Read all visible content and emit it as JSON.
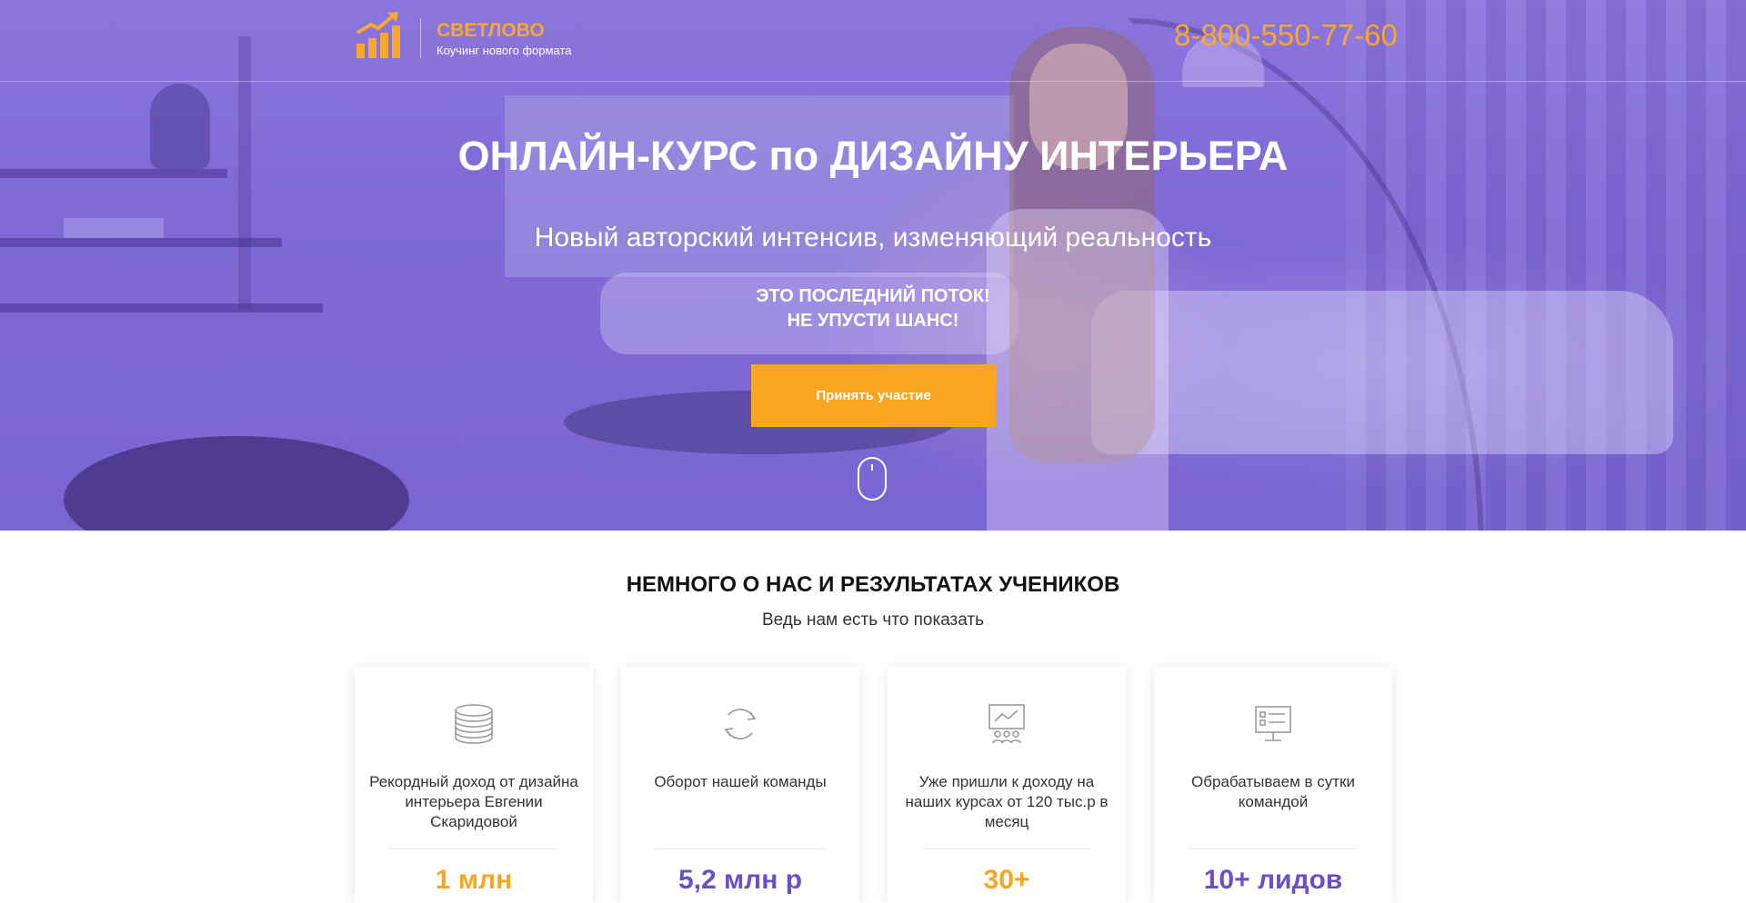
{
  "header": {
    "logo_title": "СВЕТЛОВО",
    "logo_subtitle": "Коучинг нового формата",
    "phone": "8-800-550-77-60"
  },
  "hero": {
    "title": "ОНЛАЙН-КУРС по ДИЗАЙНУ ИНТЕРЬЕРА",
    "subtitle": "Новый авторский интенсив, изменяющий реальность",
    "urgent_line1": "ЭТО ПОСЛЕДНИЙ ПОТОК!",
    "urgent_line2": "НЕ УПУСТИ ШАНС!",
    "cta_label": "Принять участие"
  },
  "about": {
    "title": "НЕМНОГО О НАС И РЕЗУЛЬТАТАХ УЧЕНИКОВ",
    "subtitle": "Ведь нам есть что показать",
    "cards": [
      {
        "icon": "coins-icon",
        "text": "Рекордный доход от дизайна интерьера Евгении Скаридовой",
        "value": "1 млн",
        "value_color": "#f8a620"
      },
      {
        "icon": "refresh-icon",
        "text": "Оборот нашей команды",
        "value": "5,2 млн р",
        "value_color": "#6b4fc4"
      },
      {
        "icon": "presentation-icon",
        "text": "Уже пришли к доходу на наших курсах от 120 тыс.р в месяц",
        "value": "30+",
        "value_color": "#f8a620"
      },
      {
        "icon": "monitor-icon",
        "text": "Обрабатываем в сутки командой",
        "value": "10+ лидов",
        "value_color": "#6b4fc4"
      }
    ]
  },
  "colors": {
    "accent_orange": "#f8a620",
    "hero_overlay": "#7f6ad6",
    "accent_purple": "#6b4fc4"
  }
}
